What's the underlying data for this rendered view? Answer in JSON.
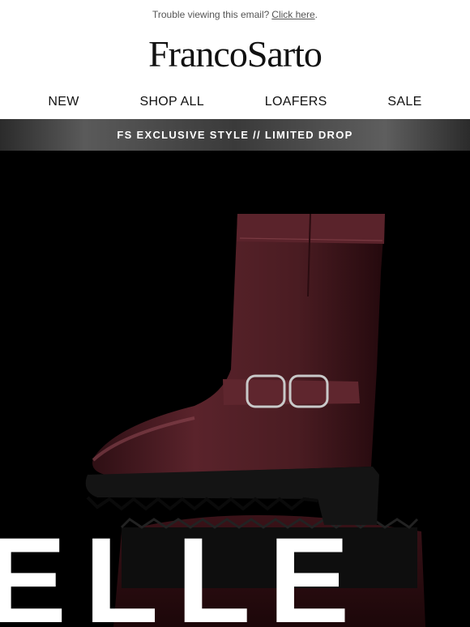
{
  "preheader": {
    "text": "Trouble viewing this email?",
    "link_label": "Click here",
    "suffix": "."
  },
  "brand": {
    "logo_text": "FrancoSarto"
  },
  "nav": {
    "items": [
      {
        "label": "NEW"
      },
      {
        "label": "SHOP ALL"
      },
      {
        "label": "LOAFERS"
      },
      {
        "label": "SALE"
      }
    ]
  },
  "banner": {
    "text": "FS EXCLUSIVE STYLE // LIMITED DROP"
  },
  "hero": {
    "headline": "ELLE",
    "image_icon": "burgundy-moto-boot-image",
    "colors": {
      "boot": "#4a1c22",
      "sole": "#121212",
      "background": "#000000"
    }
  }
}
